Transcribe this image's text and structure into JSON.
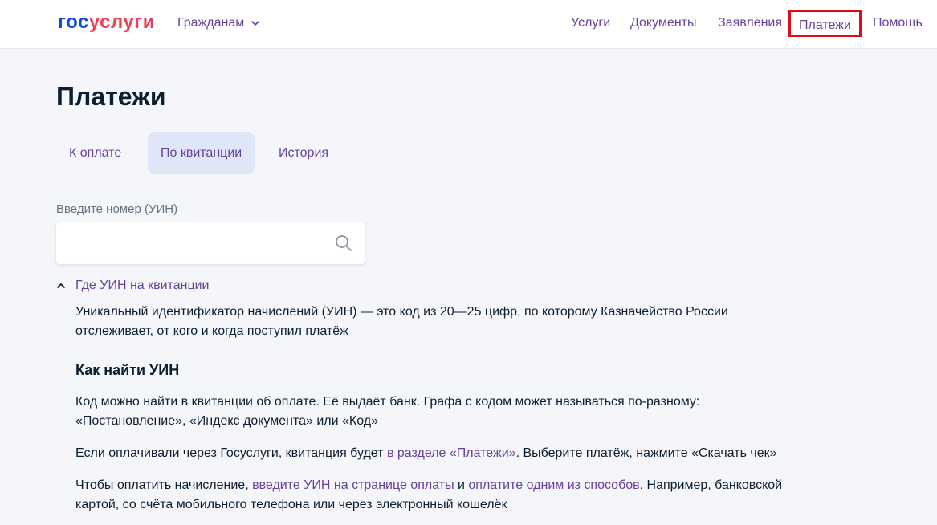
{
  "header": {
    "logo_part1": "гос",
    "logo_part2": "услуги",
    "audience": "Гражданам",
    "nav": {
      "services": "Услуги",
      "documents": "Документы",
      "applications": "Заявления",
      "payments": "Платежи",
      "help": "Помощь"
    }
  },
  "page": {
    "title": "Платежи",
    "tabs": {
      "to_pay": "К оплате",
      "by_receipt": "По квитанции",
      "history": "История"
    },
    "uin_label": "Введите номер (УИН)",
    "uin_value": "",
    "uin_placeholder": "",
    "expander_label": "Где УИН на квитанции",
    "description_line1": "Уникальный идентификатор начислений (УИН) — это код из 20—25 цифр, по которому Казначейство России",
    "description_line2": "отслеживает, от кого и когда поступил платёж",
    "how_to_find_title": "Как найти УИН",
    "p1_line1": "Код можно найти в квитанции об оплате. Её выдаёт банк. Графа с кодом может называться по-разному:",
    "p1_line2": "«Постановление», «Индекс документа» или «Код»",
    "p2_text1": "Если оплачивали через Госуслуги, квитанция будет ",
    "p2_link": "в разделе «Платежи»",
    "p2_text2": ". Выберите платёж, нажмите «Скачать чек»",
    "p3_text1": "Чтобы оплатить начисление, ",
    "p3_link1": "введите УИН на странице оплаты",
    "p3_text2": " и ",
    "p3_link2": "оплатите одним из способов",
    "p3_text3": ". Например, банковской",
    "p3_line2": "картой, со счёта мобильного телефона или через электронный кошелёк"
  },
  "colors": {
    "brand_blue": "#0d4cd3",
    "brand_red": "#ee3f58",
    "link_purple": "#66429a",
    "highlight_red": "#e10b16",
    "selected_tab_bg": "#dfe6f8"
  },
  "icons": {
    "audience_chevron": "chevron-down-icon",
    "search": "search-icon",
    "expander": "chevron-up-icon"
  }
}
